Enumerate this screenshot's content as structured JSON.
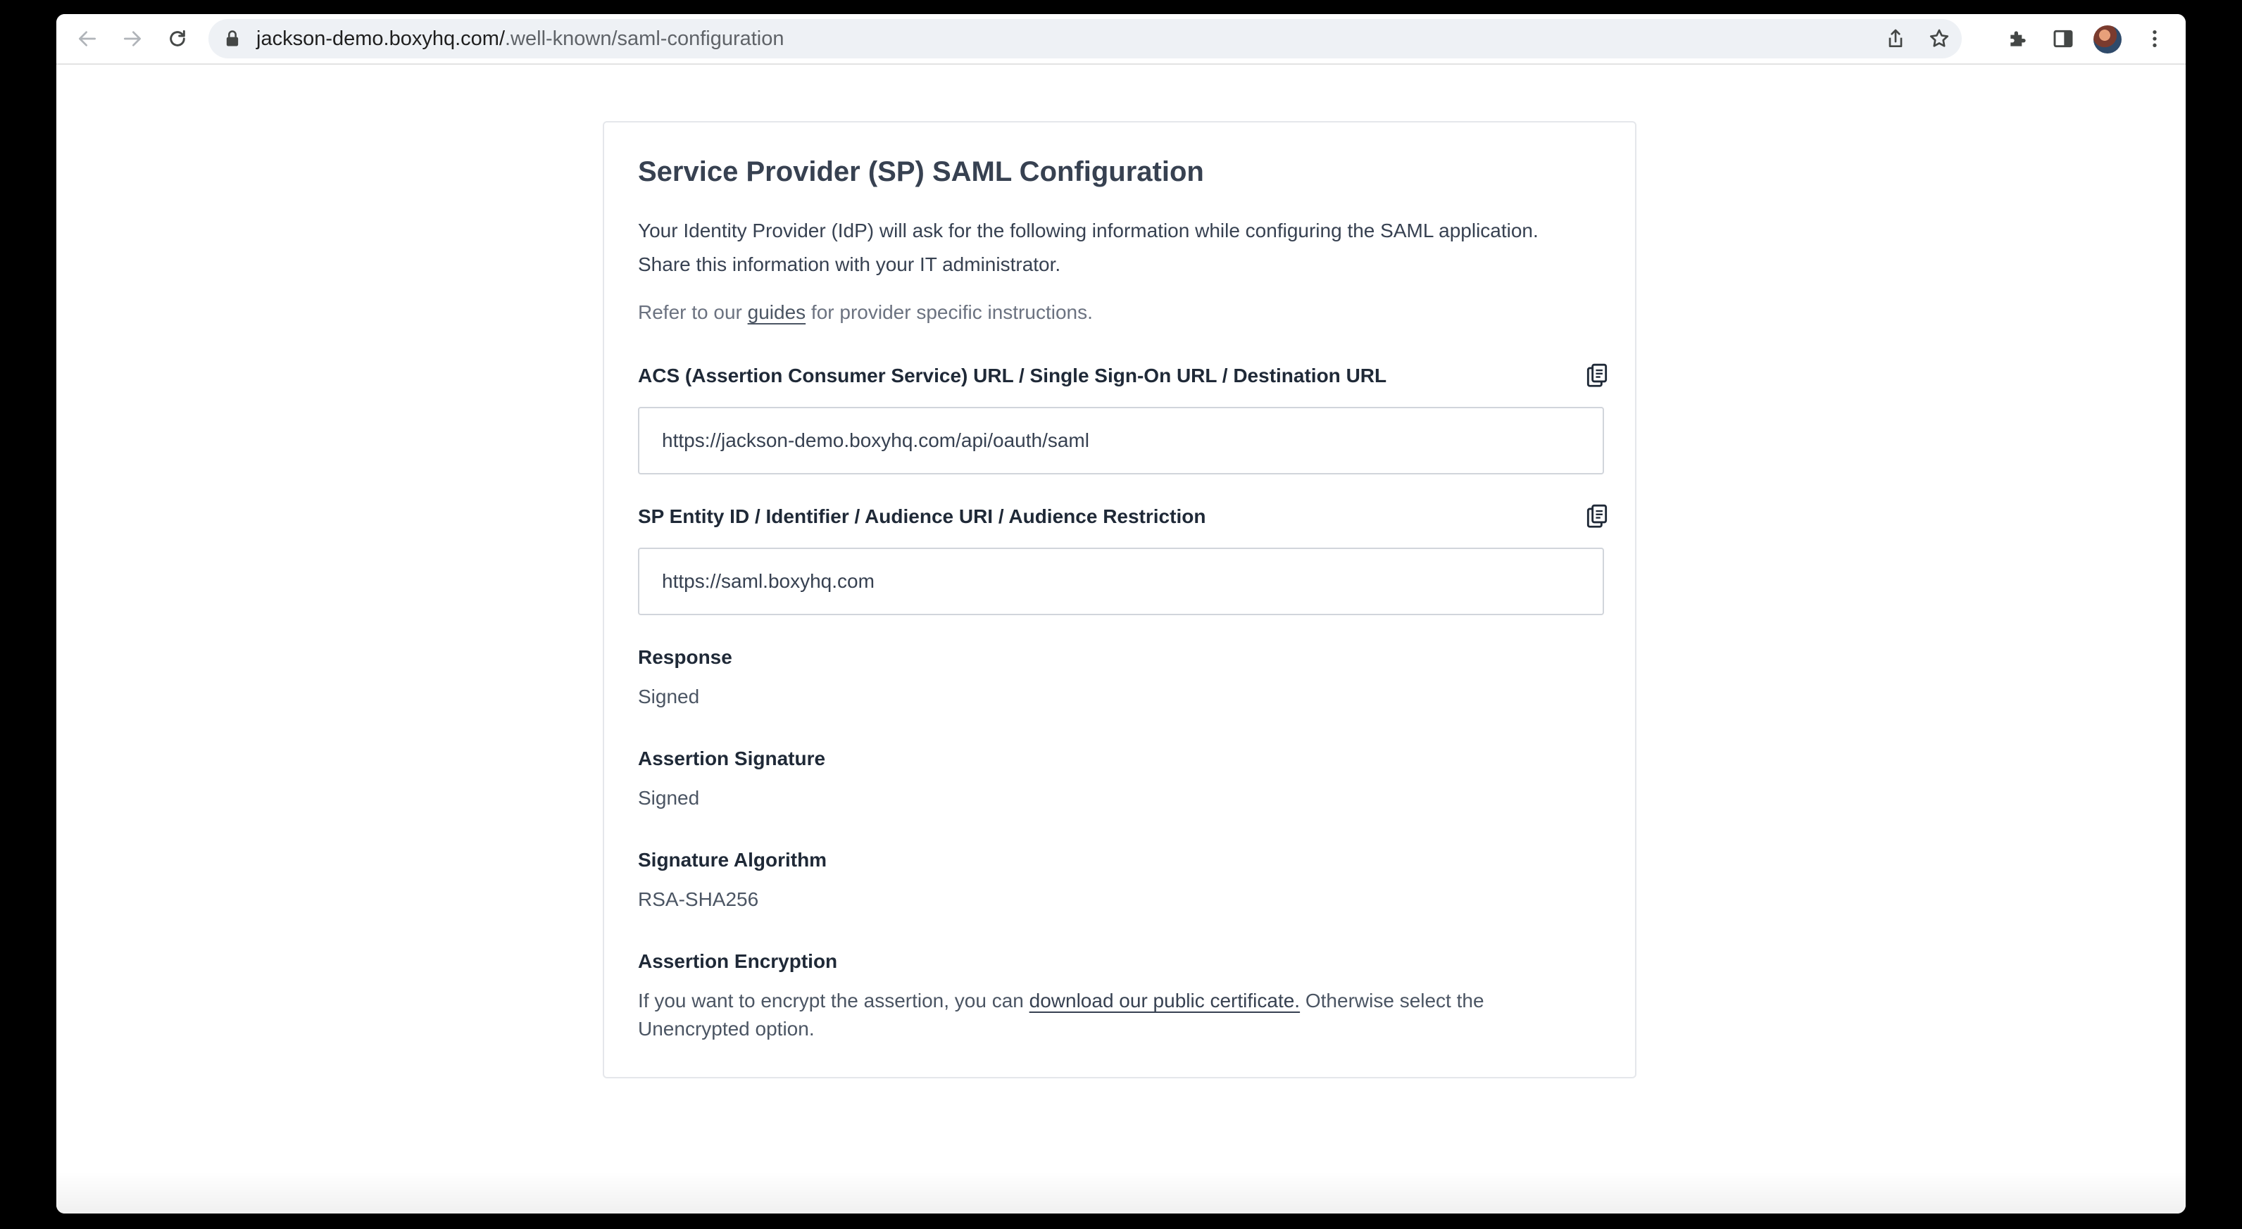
{
  "browser": {
    "url_host": "jackson-demo.boxyhq.com/",
    "url_path": ".well-known/saml-configuration",
    "icons": [
      "back-arrow-icon",
      "forward-arrow-icon",
      "reload-icon",
      "lock-icon",
      "share-icon",
      "bookmark-star-icon",
      "extensions-puzzle-icon",
      "side-panel-icon",
      "avatar",
      "kebab-menu-icon"
    ]
  },
  "card": {
    "title": "Service Provider (SP) SAML Configuration",
    "intro": "Your Identity Provider (IdP) will ask for the following information while configuring the SAML application. Share this information with your IT administrator.",
    "refer_prefix": "Refer to our ",
    "refer_link": "guides",
    "refer_suffix": " for provider specific instructions.",
    "acs": {
      "label": "ACS (Assertion Consumer Service) URL / Single Sign-On URL / Destination URL",
      "value": "https://jackson-demo.boxyhq.com/api/oauth/saml"
    },
    "entity": {
      "label": "SP Entity ID / Identifier / Audience URI / Audience Restriction",
      "value": "https://saml.boxyhq.com"
    },
    "response": {
      "label": "Response",
      "value": "Signed"
    },
    "assertion_signature": {
      "label": "Assertion Signature",
      "value": "Signed"
    },
    "signature_algorithm": {
      "label": "Signature Algorithm",
      "value": "RSA-SHA256"
    },
    "assertion_encryption": {
      "label": "Assertion Encryption",
      "text_prefix": "If you want to encrypt the assertion, you can ",
      "link": "download our public certificate.",
      "text_suffix": " Otherwise select the Unencrypted option."
    }
  },
  "colors": {
    "text_dark": "#1f2937",
    "text_muted": "#4b5563",
    "border": "#d1d5db",
    "omnibox_bg": "#eef1f5"
  }
}
